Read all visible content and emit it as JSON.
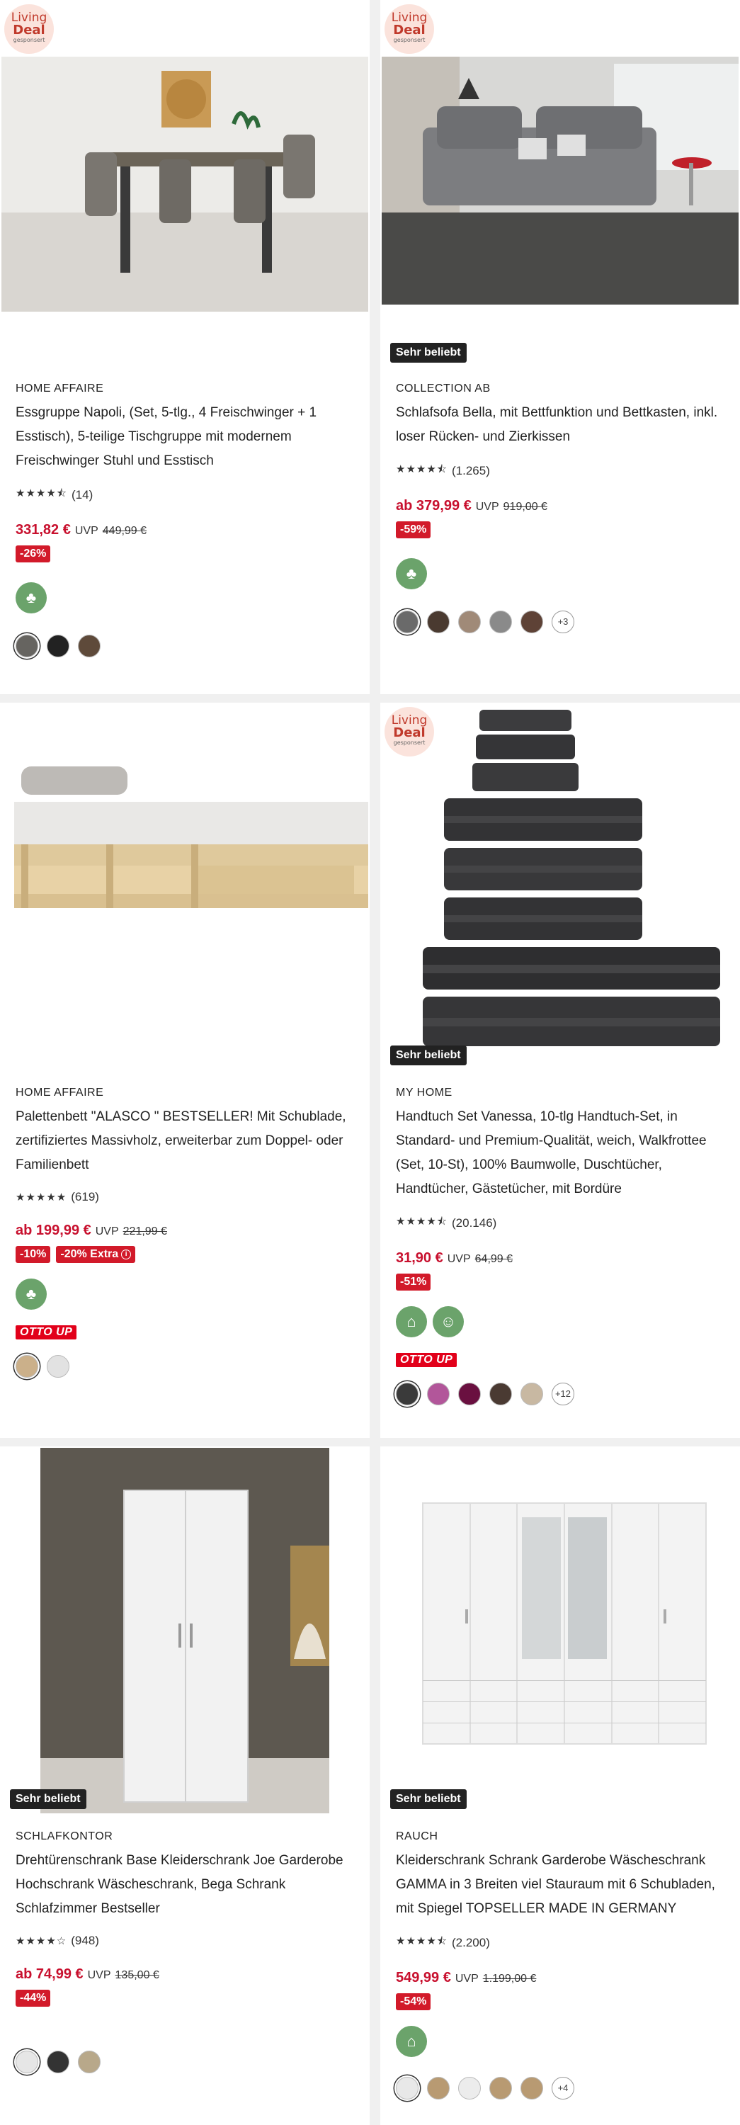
{
  "products": [
    {
      "deal_badge": {
        "line1": "Living",
        "line2": "Deal",
        "line3": "gesponsert"
      },
      "popular_badge": "",
      "brand": "HOME AFFAIRE",
      "title": "Essgruppe Napoli, (Set, 5-tlg., 4 Freischwinger + 1 Esstisch), 5-teilige Tischgruppe mit modernem Freischwinger Stuhl und Esstisch",
      "stars": "★★★★⯪",
      "rating_count": "(14)",
      "price": "331,82 €",
      "uvp_label": "UVP",
      "uvp_price": "449,99 €",
      "discounts": [
        "-26%"
      ],
      "eco_icons": [
        "tree-icon"
      ],
      "otto_up": "",
      "swatches": [
        "#666460",
        "#222222",
        "#5e4a3a"
      ],
      "more_colors": ""
    },
    {
      "deal_badge": {
        "line1": "Living",
        "line2": "Deal",
        "line3": "gesponsert"
      },
      "popular_badge": "Sehr beliebt",
      "brand": "COLLECTION AB",
      "title": "Schlafsofa Bella, mit Bettfunktion und Bettkasten, inkl. loser Rücken- und Zierkissen",
      "stars": "★★★★⯪",
      "rating_count": "(1.265)",
      "price": "ab 379,99 €",
      "uvp_label": "UVP",
      "uvp_price": "919,00 €",
      "discounts": [
        "-59%"
      ],
      "eco_icons": [
        "tree-icon"
      ],
      "otto_up": "",
      "swatches": [
        "#6a6a6a",
        "#4a3a30",
        "#a08a78",
        "#8a8a8a",
        "#5e4236"
      ],
      "more_colors": "+3"
    },
    {
      "deal_badge": null,
      "popular_badge": "",
      "brand": "HOME AFFAIRE",
      "title": "Palettenbett \"ALASCO \" BESTSELLER! Mit Schublade, zertifiziertes Massivholz, erweiterbar zum Doppel- oder Familienbett",
      "stars": "★★★★★",
      "rating_count": "(619)",
      "price": "ab 199,99 €",
      "uvp_label": "UVP",
      "uvp_price": "221,99 €",
      "discounts": [
        "-10%"
      ],
      "extra_discount": "-20% Extra",
      "eco_icons": [
        "tree-icon"
      ],
      "otto_up": "OTTO UP",
      "swatches": [
        "#cbb08a",
        "#e2e2e2"
      ],
      "more_colors": ""
    },
    {
      "deal_badge": {
        "line1": "Living",
        "line2": "Deal",
        "line3": "gesponsert"
      },
      "popular_badge": "Sehr beliebt",
      "brand": "MY HOME",
      "title": "Handtuch Set Vanessa, 10-tlg Handtuch-Set, in Standard- und Premium-Qualität, weich, Walkfrottee (Set, 10-St), 100% Baumwolle, Duschtücher, Handtücher, Gästetücher, mit Bordüre",
      "stars": "★★★★⯪",
      "rating_count": "(20.146)",
      "price": "31,90 €",
      "uvp_label": "UVP",
      "uvp_price": "64,99 €",
      "discounts": [
        "-51%"
      ],
      "eco_icons": [
        "factory-icon",
        "people-icon"
      ],
      "otto_up": "OTTO UP",
      "swatches": [
        "#3a3a3a",
        "#b2569a",
        "#6a1040",
        "#4a3a32",
        "#c8b8a2"
      ],
      "more_colors": "+12"
    },
    {
      "deal_badge": null,
      "popular_badge": "Sehr beliebt",
      "brand": "SCHLAFKONTOR",
      "title": "Drehtürenschrank Base Kleiderschrank Joe Garderobe Hochschrank Wäscheschrank, Bega Schrank Schlafzimmer Bestseller",
      "stars": "★★★★☆",
      "rating_count": "(948)",
      "price": "ab 74,99 €",
      "uvp_label": "UVP",
      "uvp_price": "135,00 €",
      "discounts": [
        "-44%"
      ],
      "eco_icons": [],
      "otto_up": "",
      "swatches": [
        "#e6e6e6",
        "#333333",
        "#b8a88a"
      ],
      "more_colors": ""
    },
    {
      "deal_badge": null,
      "popular_badge": "Sehr beliebt",
      "brand": "RAUCH",
      "title": "Kleiderschrank Schrank Garderobe Wäscheschrank GAMMA in 3 Breiten viel Stauraum mit 6 Schubladen, mit Spiegel TOPSELLER MADE IN GERMANY",
      "stars": "★★★★⯪",
      "rating_count": "(2.200)",
      "price": "549,99 €",
      "uvp_label": "UVP",
      "uvp_price": "1.199,00 €",
      "discounts": [
        "-54%"
      ],
      "eco_icons": [
        "factory-icon"
      ],
      "otto_up": "",
      "swatches": [
        "#e8e8e8",
        "#b89a72",
        "#ececec",
        "#b89a72",
        "#b89a72"
      ],
      "more_colors": "+4"
    }
  ]
}
